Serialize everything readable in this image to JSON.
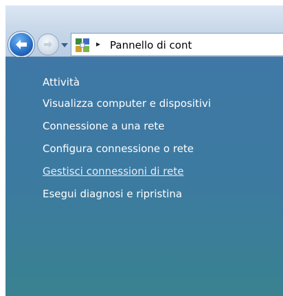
{
  "breadcrumb": {
    "separator": "▸",
    "current": "Pannello di cont"
  },
  "taskpane": {
    "heading": "Attività",
    "items": [
      {
        "label": "Visualizza computer e dispositivi"
      },
      {
        "label": "Connessione a una rete"
      },
      {
        "label": "Configura connessione o rete"
      },
      {
        "label": "Gestisci connessioni di rete"
      },
      {
        "label": "Esegui diagnosi e ripristina"
      }
    ]
  },
  "icons": {
    "back": "back-arrow-icon",
    "forward": "forward-arrow-icon",
    "history": "chevron-down-icon",
    "control_panel": "control-panel-icon"
  },
  "colors": {
    "taskpane_top": "#3f78a6",
    "taskpane_bottom": "#3a8290",
    "back_button": "#2a73c9",
    "link_text": "#ffffff"
  }
}
